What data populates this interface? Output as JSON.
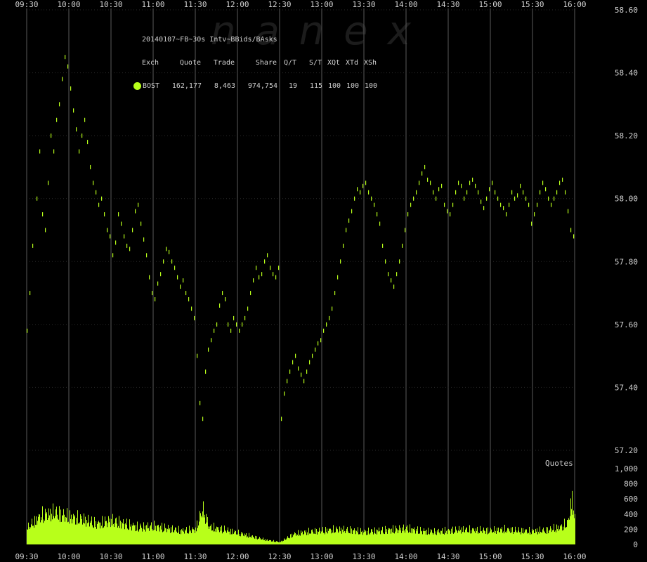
{
  "watermark": "nanex",
  "legend": {
    "title": "20140107~FB~30s Intv~BBids/BAsks",
    "headers": [
      "Exch",
      "Quote",
      "Trade",
      "Share",
      "Q/T",
      "S/T",
      "XQt",
      "XTd",
      "XSh"
    ],
    "row": [
      "BOST",
      "162,177",
      "8,463",
      "974,754",
      "19",
      "115",
      "100",
      "100",
      "100"
    ],
    "dot_color": "#b8ff1a"
  },
  "colors": {
    "background": "#000000",
    "data": "#b8ff1a",
    "grid": "#5a5a5a",
    "text": "#d0d0d0"
  },
  "chart_data": [
    {
      "type": "scatter",
      "title": "",
      "x_ticks": [
        "09:30",
        "10:00",
        "10:30",
        "11:00",
        "11:30",
        "12:00",
        "12:30",
        "13:00",
        "13:30",
        "14:00",
        "14:30",
        "15:00",
        "15:30",
        "16:00"
      ],
      "y_ticks": [
        "58.60",
        "58.40",
        "58.20",
        "58.00",
        "57.80",
        "57.60",
        "57.40",
        "57.20"
      ],
      "ylim": [
        57.2,
        58.6
      ],
      "xlim": [
        "09:30",
        "16:00"
      ],
      "grid": "vertical",
      "series": [
        {
          "points": [
            [
              "09:30",
              57.58
            ],
            [
              "09:32",
              57.7
            ],
            [
              "09:34",
              57.85
            ],
            [
              "09:37",
              58.0
            ],
            [
              "09:39",
              58.15
            ],
            [
              "09:41",
              57.95
            ],
            [
              "09:43",
              57.9
            ],
            [
              "09:45",
              58.05
            ],
            [
              "09:47",
              58.2
            ],
            [
              "09:49",
              58.15
            ],
            [
              "09:51",
              58.25
            ],
            [
              "09:53",
              58.3
            ],
            [
              "09:55",
              58.38
            ],
            [
              "09:57",
              58.45
            ],
            [
              "09:59",
              58.42
            ],
            [
              "10:01",
              58.35
            ],
            [
              "10:03",
              58.28
            ],
            [
              "10:05",
              58.22
            ],
            [
              "10:07",
              58.15
            ],
            [
              "10:09",
              58.2
            ],
            [
              "10:11",
              58.25
            ],
            [
              "10:13",
              58.18
            ],
            [
              "10:15",
              58.1
            ],
            [
              "10:17",
              58.05
            ],
            [
              "10:19",
              58.02
            ],
            [
              "10:21",
              57.98
            ],
            [
              "10:23",
              58.0
            ],
            [
              "10:25",
              57.95
            ],
            [
              "10:27",
              57.9
            ],
            [
              "10:29",
              57.88
            ],
            [
              "10:31",
              57.82
            ],
            [
              "10:33",
              57.86
            ],
            [
              "10:35",
              57.95
            ],
            [
              "10:37",
              57.92
            ],
            [
              "10:39",
              57.88
            ],
            [
              "10:41",
              57.85
            ],
            [
              "10:43",
              57.84
            ],
            [
              "10:45",
              57.9
            ],
            [
              "10:47",
              57.96
            ],
            [
              "10:49",
              57.98
            ],
            [
              "10:51",
              57.92
            ],
            [
              "10:53",
              57.87
            ],
            [
              "10:55",
              57.82
            ],
            [
              "10:57",
              57.75
            ],
            [
              "10:59",
              57.7
            ],
            [
              "11:01",
              57.68
            ],
            [
              "11:03",
              57.73
            ],
            [
              "11:05",
              57.76
            ],
            [
              "11:07",
              57.8
            ],
            [
              "11:09",
              57.84
            ],
            [
              "11:11",
              57.83
            ],
            [
              "11:13",
              57.8
            ],
            [
              "11:15",
              57.78
            ],
            [
              "11:17",
              57.75
            ],
            [
              "11:19",
              57.72
            ],
            [
              "11:21",
              57.74
            ],
            [
              "11:23",
              57.7
            ],
            [
              "11:25",
              57.68
            ],
            [
              "11:27",
              57.65
            ],
            [
              "11:29",
              57.62
            ],
            [
              "11:31",
              57.5
            ],
            [
              "11:33",
              57.35
            ],
            [
              "11:35",
              57.3
            ],
            [
              "11:37",
              57.45
            ],
            [
              "11:39",
              57.52
            ],
            [
              "11:41",
              57.55
            ],
            [
              "11:43",
              57.58
            ],
            [
              "11:45",
              57.6
            ],
            [
              "11:47",
              57.66
            ],
            [
              "11:49",
              57.7
            ],
            [
              "11:51",
              57.68
            ],
            [
              "11:53",
              57.6
            ],
            [
              "11:55",
              57.58
            ],
            [
              "11:57",
              57.62
            ],
            [
              "11:59",
              57.6
            ],
            [
              "12:01",
              57.58
            ],
            [
              "12:03",
              57.6
            ],
            [
              "12:05",
              57.62
            ],
            [
              "12:07",
              57.65
            ],
            [
              "12:09",
              57.7
            ],
            [
              "12:11",
              57.74
            ],
            [
              "12:13",
              57.78
            ],
            [
              "12:15",
              57.75
            ],
            [
              "12:17",
              57.76
            ],
            [
              "12:19",
              57.8
            ],
            [
              "12:21",
              57.82
            ],
            [
              "12:23",
              57.78
            ],
            [
              "12:25",
              57.76
            ],
            [
              "12:27",
              57.75
            ],
            [
              "12:29",
              57.78
            ],
            [
              "12:31",
              57.3
            ],
            [
              "12:33",
              57.38
            ],
            [
              "12:35",
              57.42
            ],
            [
              "12:37",
              57.45
            ],
            [
              "12:39",
              57.48
            ],
            [
              "12:41",
              57.5
            ],
            [
              "12:43",
              57.46
            ],
            [
              "12:45",
              57.44
            ],
            [
              "12:47",
              57.42
            ],
            [
              "12:49",
              57.45
            ],
            [
              "12:51",
              57.48
            ],
            [
              "12:53",
              57.5
            ],
            [
              "12:55",
              57.52
            ],
            [
              "12:57",
              57.54
            ],
            [
              "12:59",
              57.55
            ],
            [
              "13:01",
              57.58
            ],
            [
              "13:03",
              57.6
            ],
            [
              "13:05",
              57.62
            ],
            [
              "13:07",
              57.65
            ],
            [
              "13:09",
              57.7
            ],
            [
              "13:11",
              57.75
            ],
            [
              "13:13",
              57.8
            ],
            [
              "13:15",
              57.85
            ],
            [
              "13:17",
              57.9
            ],
            [
              "13:19",
              57.93
            ],
            [
              "13:21",
              57.96
            ],
            [
              "13:23",
              58.0
            ],
            [
              "13:25",
              58.03
            ],
            [
              "13:27",
              58.02
            ],
            [
              "13:29",
              58.04
            ],
            [
              "13:31",
              58.05
            ],
            [
              "13:33",
              58.02
            ],
            [
              "13:35",
              58.0
            ],
            [
              "13:37",
              57.98
            ],
            [
              "13:39",
              57.95
            ],
            [
              "13:41",
              57.92
            ],
            [
              "13:43",
              57.85
            ],
            [
              "13:45",
              57.8
            ],
            [
              "13:47",
              57.76
            ],
            [
              "13:49",
              57.74
            ],
            [
              "13:51",
              57.72
            ],
            [
              "13:53",
              57.76
            ],
            [
              "13:55",
              57.8
            ],
            [
              "13:57",
              57.85
            ],
            [
              "13:59",
              57.9
            ],
            [
              "14:01",
              57.95
            ],
            [
              "14:03",
              57.98
            ],
            [
              "14:05",
              58.0
            ],
            [
              "14:07",
              58.02
            ],
            [
              "14:09",
              58.05
            ],
            [
              "14:11",
              58.08
            ],
            [
              "14:13",
              58.1
            ],
            [
              "14:15",
              58.06
            ],
            [
              "14:17",
              58.05
            ],
            [
              "14:19",
              58.02
            ],
            [
              "14:21",
              58.0
            ],
            [
              "14:23",
              58.03
            ],
            [
              "14:25",
              58.04
            ],
            [
              "14:27",
              57.98
            ],
            [
              "14:29",
              57.96
            ],
            [
              "14:31",
              57.95
            ],
            [
              "14:33",
              57.98
            ],
            [
              "14:35",
              58.02
            ],
            [
              "14:37",
              58.05
            ],
            [
              "14:39",
              58.04
            ],
            [
              "14:41",
              58.0
            ],
            [
              "14:43",
              58.02
            ],
            [
              "14:45",
              58.05
            ],
            [
              "14:47",
              58.06
            ],
            [
              "14:49",
              58.04
            ],
            [
              "14:51",
              58.02
            ],
            [
              "14:53",
              57.99
            ],
            [
              "14:55",
              57.97
            ],
            [
              "14:57",
              58.0
            ],
            [
              "14:59",
              58.03
            ],
            [
              "15:01",
              58.05
            ],
            [
              "15:03",
              58.02
            ],
            [
              "15:05",
              58.0
            ],
            [
              "15:07",
              57.98
            ],
            [
              "15:09",
              57.97
            ],
            [
              "15:11",
              57.95
            ],
            [
              "15:13",
              57.98
            ],
            [
              "15:15",
              58.02
            ],
            [
              "15:17",
              58.0
            ],
            [
              "15:19",
              58.01
            ],
            [
              "15:21",
              58.04
            ],
            [
              "15:23",
              58.02
            ],
            [
              "15:25",
              58.0
            ],
            [
              "15:27",
              57.98
            ],
            [
              "15:29",
              57.92
            ],
            [
              "15:31",
              57.95
            ],
            [
              "15:33",
              57.98
            ],
            [
              "15:35",
              58.02
            ],
            [
              "15:37",
              58.05
            ],
            [
              "15:39",
              58.03
            ],
            [
              "15:41",
              58.0
            ],
            [
              "15:43",
              57.98
            ],
            [
              "15:45",
              58.0
            ],
            [
              "15:47",
              58.02
            ],
            [
              "15:49",
              58.05
            ],
            [
              "15:51",
              58.06
            ],
            [
              "15:53",
              58.02
            ],
            [
              "15:55",
              57.96
            ],
            [
              "15:57",
              57.9
            ],
            [
              "15:59",
              57.88
            ]
          ]
        }
      ]
    },
    {
      "type": "area",
      "title": "Quotes",
      "y_ticks": [
        "1,000",
        "800",
        "600",
        "400",
        "200",
        "0"
      ],
      "ylim": [
        0,
        1000
      ],
      "xlim": [
        "09:30",
        "16:00"
      ],
      "x": [
        "09:30",
        "09:40",
        "09:50",
        "10:00",
        "10:10",
        "10:20",
        "10:30",
        "10:40",
        "10:50",
        "11:00",
        "11:10",
        "11:20",
        "11:30",
        "11:35",
        "11:40",
        "11:50",
        "12:00",
        "12:10",
        "12:20",
        "12:30",
        "12:40",
        "12:50",
        "13:00",
        "13:10",
        "13:20",
        "13:30",
        "13:40",
        "13:50",
        "14:00",
        "14:10",
        "14:20",
        "14:30",
        "14:40",
        "14:50",
        "15:00",
        "15:10",
        "15:20",
        "15:30",
        "15:40",
        "15:50",
        "15:55",
        "15:58",
        "16:00"
      ],
      "values": [
        280,
        500,
        560,
        480,
        440,
        360,
        420,
        360,
        300,
        320,
        280,
        240,
        260,
        620,
        300,
        260,
        200,
        140,
        80,
        40,
        180,
        220,
        240,
        260,
        250,
        220,
        240,
        260,
        280,
        240,
        220,
        240,
        260,
        250,
        240,
        260,
        240,
        230,
        250,
        300,
        380,
        800,
        420
      ]
    }
  ]
}
